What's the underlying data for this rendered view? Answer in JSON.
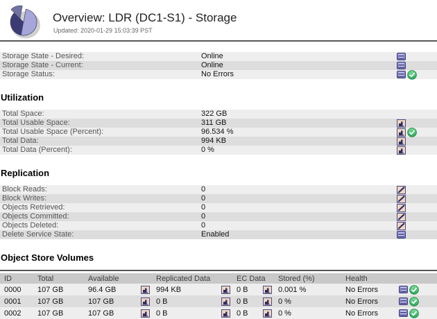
{
  "header": {
    "title": "Overview: LDR (DC1-S1) - Storage",
    "updated": "Updated: 2020-01-29 15:03:39 PST"
  },
  "sections": [
    {
      "rows": [
        {
          "label": "Storage State - Desired:",
          "value": "Online"
        },
        {
          "label": "Storage State - Current:",
          "value": "Online"
        },
        {
          "label": "Storage Status:",
          "value": "No Errors"
        }
      ]
    },
    {
      "heading": "Utilization",
      "rows": [
        {
          "label": "Total Space:",
          "value": "322 GB"
        },
        {
          "label": "Total Usable Space:",
          "value": "311 GB"
        },
        {
          "label": "Total Usable Space (Percent):",
          "value": "96.534 %"
        },
        {
          "label": "Total Data:",
          "value": "994 KB"
        },
        {
          "label": "Total Data (Percent):",
          "value": "0 %"
        }
      ]
    },
    {
      "heading": "Replication",
      "rows": [
        {
          "label": "Block Reads:",
          "value": "0"
        },
        {
          "label": "Block Writes:",
          "value": "0"
        },
        {
          "label": "Objects Retrieved:",
          "value": "0"
        },
        {
          "label": "Objects Committed:",
          "value": "0"
        },
        {
          "label": "Objects Deleted:",
          "value": "0"
        },
        {
          "label": "Delete Service State:",
          "value": "Enabled"
        }
      ]
    }
  ],
  "volumes": {
    "heading": "Object Store Volumes",
    "columns": [
      "ID",
      "Total",
      "Available",
      "Replicated Data",
      "EC Data",
      "Stored (%)",
      "Health"
    ],
    "rows": [
      [
        "0000",
        "107 GB",
        "96.4 GB",
        "994 KB",
        "0 B",
        "0.001 %",
        "No Errors"
      ],
      [
        "0001",
        "107 GB",
        "107 GB",
        "0 B",
        "0 B",
        "0 %",
        "No Errors"
      ],
      [
        "0002",
        "107 GB",
        "107 GB",
        "0 B",
        "0 B",
        "0 %",
        "No Errors"
      ]
    ]
  },
  "icons": {
    "pie": "pie-chart-logo",
    "state": "state-icon",
    "chart": "chart-icon",
    "trend": "trend-icon",
    "check": "green-check-icon"
  },
  "colors": {
    "row_light": "#eeeeee",
    "row_dark": "#dddddd",
    "table_header": "#c9c9c9",
    "separator": "#565656",
    "check_green": "#2aa858",
    "icon_purple": "#8a8ace",
    "icon_tan": "#eed6c0",
    "pie_light": "#a6a6d9",
    "pie_dark": "#3c3c72",
    "pie_mid": "#72729f"
  }
}
